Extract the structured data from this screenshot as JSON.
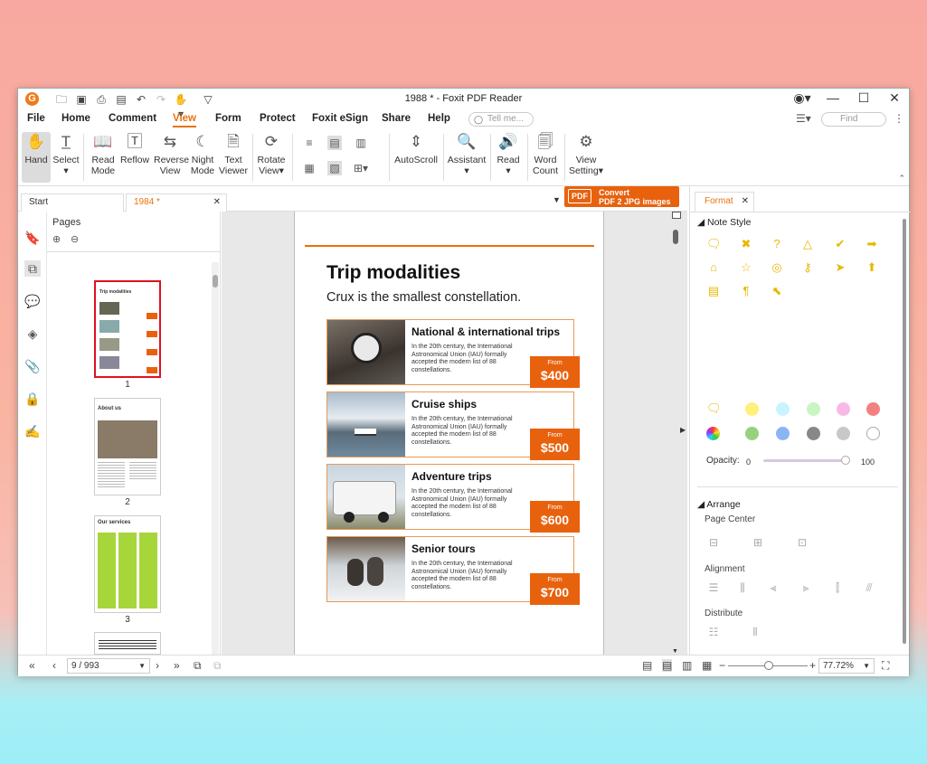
{
  "window": {
    "title": "1988 * - Foxit PDF Reader"
  },
  "menu": [
    "File",
    "Home",
    "Comment",
    "View",
    "Form",
    "Protect",
    "Foxit eSign",
    "Share",
    "Help"
  ],
  "tell_me": "Tell me...",
  "find": "Find",
  "ribbon": {
    "hand": "Hand",
    "select": "Select",
    "read_mode": [
      "Read",
      "Mode"
    ],
    "reflow": "Reflow",
    "reverse_view": [
      "Reverse",
      "View"
    ],
    "night_mode": [
      "Night",
      "Mode"
    ],
    "text_viewer": [
      "Text",
      "Viewer"
    ],
    "rotate_view": [
      "Rotate",
      "View"
    ],
    "autoscroll": "AutoScroll",
    "assistant": "Assistant",
    "read": "Read",
    "word_count": [
      "Word",
      "Count"
    ],
    "view_setting": [
      "View",
      "Setting"
    ]
  },
  "tabs": {
    "start": "Start",
    "doc": "1984 *"
  },
  "convert": [
    "Convert",
    "PDF 2 JPG images"
  ],
  "pages_panel": {
    "title": "Pages",
    "page_numbers": [
      "1",
      "2",
      "3"
    ]
  },
  "thumbnails": {
    "t1_title": "Trip modalities",
    "t2_title": "About us",
    "t3_title": "Our services"
  },
  "document": {
    "title": "Trip modalities",
    "subtitle": "Crux is the smallest constellation.",
    "cards": [
      {
        "title": "National & international trips",
        "desc": "In the 20th century, the International Astronomical Union (IAU) formally accepted the modern list of 88 constellations.",
        "from": "From",
        "price": "$400"
      },
      {
        "title": "Cruise ships",
        "desc": "In the 20th century, the International Astronomical Union (IAU) formally accepted the modern list of 88 constellations.",
        "from": "From",
        "price": "$500"
      },
      {
        "title": "Adventure trips",
        "desc": "In the 20th century, the International Astronomical Union (IAU) formally accepted the modern list of 88 constellations.",
        "from": "From",
        "price": "$600"
      },
      {
        "title": "Senior tours",
        "desc": "In the 20th century, the International Astronomical Union (IAU) formally accepted the modern list of 88 constellations.",
        "from": "From",
        "price": "$700"
      }
    ]
  },
  "format_panel": {
    "tab": "Format",
    "note_style": "Note Style",
    "opacity_label": "Opacity:",
    "opacity_min": "0",
    "opacity_max": "100",
    "opacity_value": 100,
    "arrange": "Arrange",
    "page_center": "Page Center",
    "alignment": "Alignment",
    "distribute": "Distribute",
    "colors": [
      "#fff07a",
      "#c9f3ff",
      "#c9f5c2",
      "#f9b9e6",
      "#f38080",
      "#95d17e",
      "#8ab5f4",
      "#888888",
      "#c8c8c8",
      "#ffffff"
    ]
  },
  "status": {
    "page": "9 / 993",
    "zoom": "77.72%"
  }
}
